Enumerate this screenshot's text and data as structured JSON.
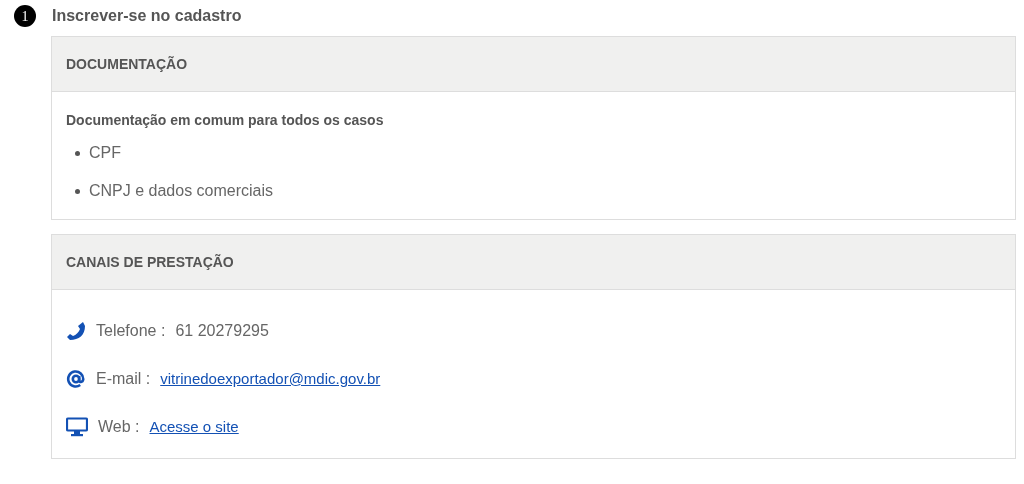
{
  "step": {
    "number": "1",
    "title": "Inscrever-se no cadastro"
  },
  "documentation": {
    "heading": "DOCUMENTAÇÃO",
    "intro": "Documentação em comum para todos os casos",
    "items": [
      "CPF",
      "CNPJ e dados comerciais"
    ]
  },
  "channels_panel": {
    "heading": "CANAIS DE PRESTAÇÃO",
    "channels": [
      {
        "kind": "phone",
        "label": "Telefone :",
        "value": "61 20279295",
        "link": false
      },
      {
        "kind": "email",
        "label": "E-mail :",
        "value": "vitrinedoexportador@mdic.gov.br",
        "link": true
      },
      {
        "kind": "web",
        "label": "Web :",
        "value": "Acesse o site",
        "link": true
      }
    ]
  }
}
